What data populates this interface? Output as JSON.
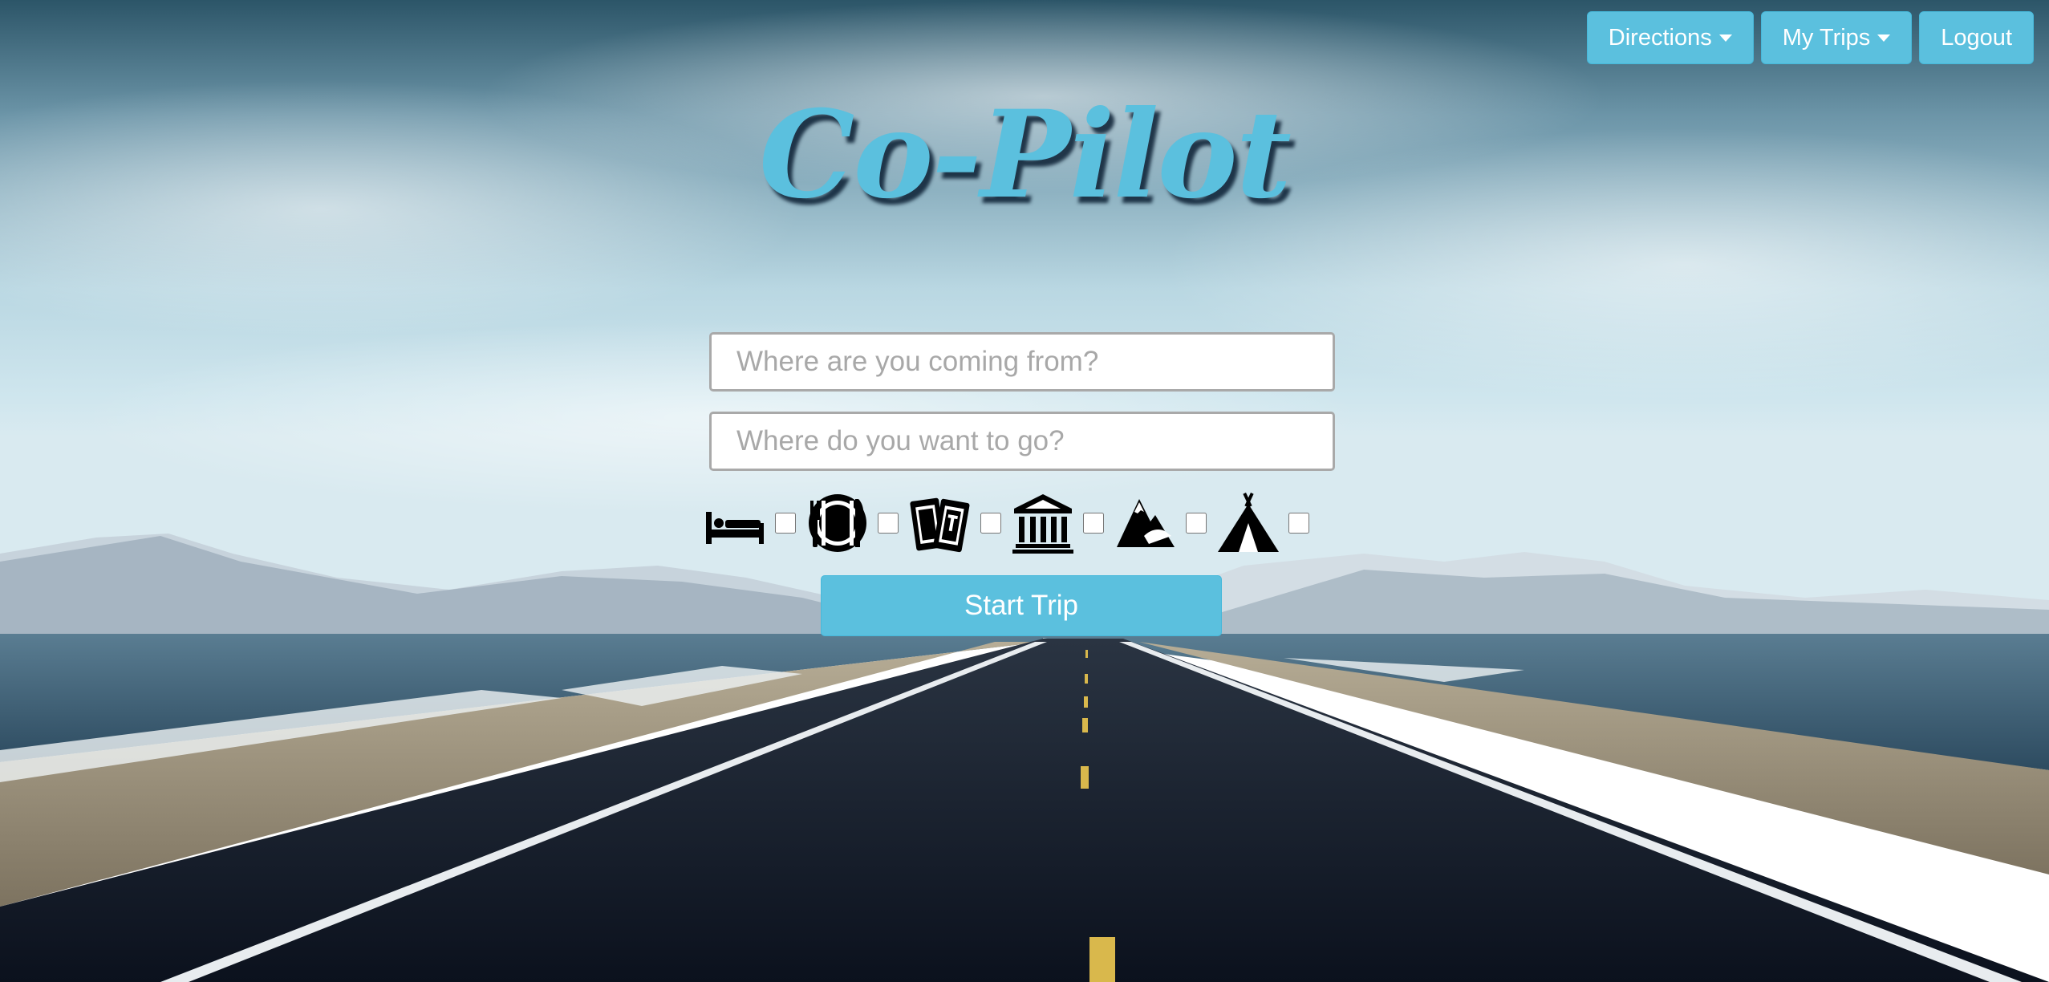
{
  "nav": {
    "directions_label": "Directions",
    "mytrips_label": "My Trips",
    "logout_label": "Logout"
  },
  "brand": {
    "title": "Co-Pilot"
  },
  "form": {
    "origin_placeholder": "Where are you coming from?",
    "destination_placeholder": "Where do you want to go?",
    "submit_label": "Start Trip"
  },
  "filters": [
    {
      "icon": "bed-icon",
      "checked": false
    },
    {
      "icon": "restaurant-icon",
      "checked": false
    },
    {
      "icon": "tickets-icon",
      "checked": false
    },
    {
      "icon": "museum-icon",
      "checked": false
    },
    {
      "icon": "mountain-icon",
      "checked": false
    },
    {
      "icon": "tent-icon",
      "checked": false
    }
  ],
  "colors": {
    "accent": "#5bc0de",
    "accent_border": "#46b8da",
    "button_text": "#ffffff"
  }
}
